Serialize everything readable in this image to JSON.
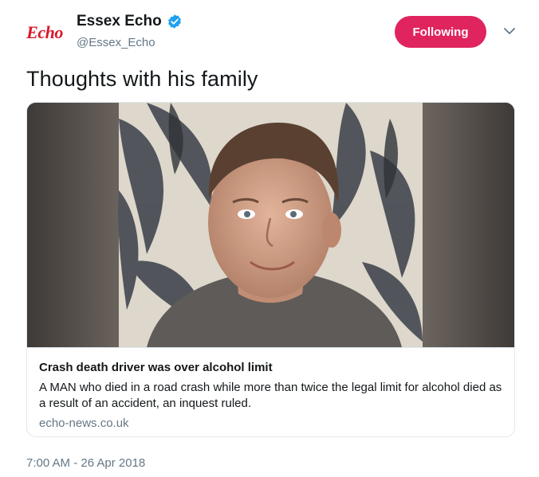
{
  "account": {
    "avatar_text": "Echo",
    "display_name": "Essex Echo",
    "verified_icon": "verified-badge-icon",
    "handle": "@Essex_Echo",
    "follow_label": "Following",
    "menu_icon": "chevron-down-icon"
  },
  "tweet": {
    "text": "Thoughts with his family",
    "timestamp": "7:00 AM - 26 Apr 2018"
  },
  "card": {
    "title": "Crash death driver was over alcohol limit",
    "description": "A MAN who died in a road crash while more than twice the legal limit for alcohol died as a result of an accident, an inquest ruled.",
    "domain": "echo-news.co.uk"
  },
  "colors": {
    "follow_button": "#e0245e",
    "verified": "#1da1f2",
    "secondary_text": "#657786",
    "brand_red": "#d8192a"
  }
}
